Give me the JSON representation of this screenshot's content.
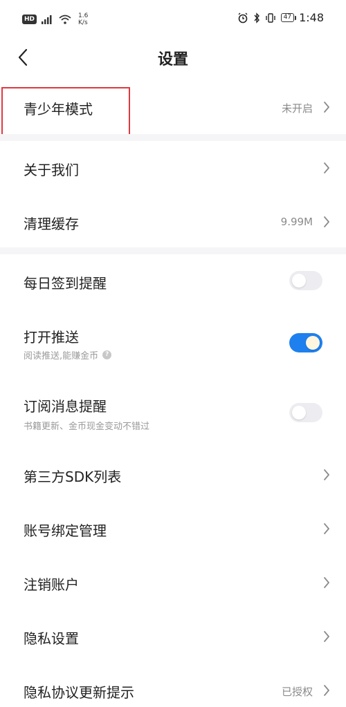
{
  "status_bar": {
    "hd": "HD",
    "net_speed_value": "1.6",
    "net_speed_unit": "K/s",
    "battery": "47",
    "time": "1:48"
  },
  "nav": {
    "title": "设置"
  },
  "rows": {
    "teen_mode": {
      "title": "青少年模式",
      "value": "未开启"
    },
    "about_us": {
      "title": "关于我们"
    },
    "clear_cache": {
      "title": "清理缓存",
      "value": "9.99M"
    },
    "checkin_reminder": {
      "title": "每日签到提醒",
      "toggle": false
    },
    "push": {
      "title": "打开推送",
      "subtitle": "阅读推送,能赚金币",
      "toggle": true
    },
    "subscription_reminder": {
      "title": "订阅消息提醒",
      "subtitle": "书籍更新、金币现金变动不错过",
      "toggle": false
    },
    "third_party_sdk": {
      "title": "第三方SDK列表"
    },
    "account_binding": {
      "title": "账号绑定管理"
    },
    "delete_account": {
      "title": "注销账户"
    },
    "privacy_settings": {
      "title": "隐私设置"
    },
    "privacy_policy_update": {
      "title": "隐私协议更新提示",
      "value": "已授权"
    }
  },
  "colors": {
    "toggle_on": "#1e80ee",
    "toggle_off": "#ededf1",
    "highlight": "#e0383d"
  }
}
